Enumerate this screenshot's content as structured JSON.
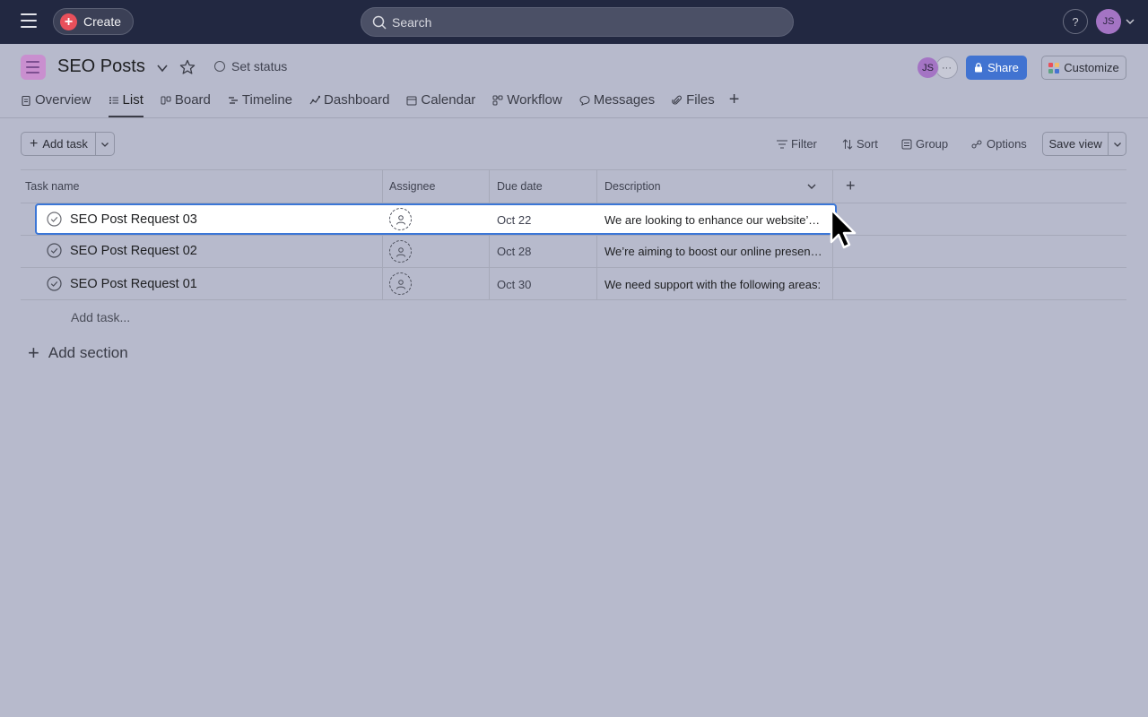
{
  "topbar": {
    "create_label": "Create",
    "search_placeholder": "Search",
    "help_label": "?",
    "user_initials": "JS"
  },
  "project": {
    "title": "SEO Posts",
    "set_status_label": "Set status",
    "member_initials": "JS",
    "member_more": "···",
    "share_label": "Share",
    "customize_label": "Customize"
  },
  "tabs": [
    {
      "label": "Overview",
      "icon": "clipboard-icon"
    },
    {
      "label": "List",
      "icon": "list-icon",
      "active": true
    },
    {
      "label": "Board",
      "icon": "board-icon"
    },
    {
      "label": "Timeline",
      "icon": "timeline-icon"
    },
    {
      "label": "Dashboard",
      "icon": "dashboard-icon"
    },
    {
      "label": "Calendar",
      "icon": "calendar-icon"
    },
    {
      "label": "Workflow",
      "icon": "workflow-icon"
    },
    {
      "label": "Messages",
      "icon": "message-icon"
    },
    {
      "label": "Files",
      "icon": "paperclip-icon"
    }
  ],
  "toolbar": {
    "add_task_label": "Add task",
    "filter_label": "Filter",
    "sort_label": "Sort",
    "group_label": "Group",
    "options_label": "Options",
    "save_view_label": "Save view"
  },
  "table": {
    "columns": [
      "Task name",
      "Assignee",
      "Due date",
      "Description"
    ],
    "rows": [
      {
        "name": "SEO Post Request 03",
        "due": "Oct 22",
        "description": "We are looking to enhance our website’s …",
        "selected": true
      },
      {
        "name": "SEO Post Request 02",
        "due": "Oct 28",
        "description": "We’re aiming to boost our online presenc…"
      },
      {
        "name": "SEO Post Request 01",
        "due": "Oct 30",
        "description": "We need support with the following areas:"
      }
    ],
    "add_task_inline": "Add task...",
    "add_section_label": "Add section"
  },
  "colors": {
    "topbar": "#222841",
    "background": "#b7bacc",
    "accent": "#4173d1",
    "avatar": "#a474c4"
  }
}
